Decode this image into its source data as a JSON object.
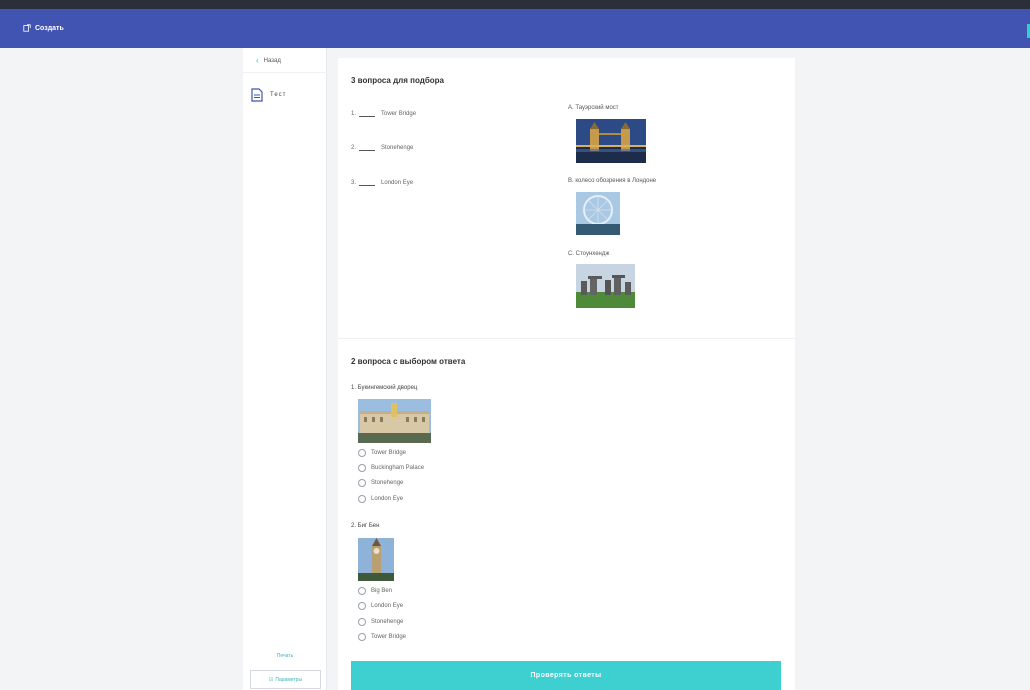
{
  "header": {
    "create_label": "Создать"
  },
  "sidebar": {
    "back_label": "Назад",
    "nav_item_label": "Тест",
    "print_label": "Печать",
    "params_label": "Параметры"
  },
  "matching": {
    "title": "3 вопроса для подбора",
    "items": [
      {
        "num": "1.",
        "text": "Tower Bridge"
      },
      {
        "num": "2.",
        "text": "Stonehenge"
      },
      {
        "num": "3.",
        "text": "London Eye"
      }
    ],
    "options": [
      {
        "label": "A. Тауэрский мост",
        "image": "tower-bridge-photo"
      },
      {
        "label": "B. колесо обозрения в Лондоне",
        "image": "london-eye-photo"
      },
      {
        "label": "C. Стоунхендж",
        "image": "stonehenge-photo"
      }
    ]
  },
  "choice": {
    "title": "2 вопроса с выбором ответа",
    "questions": [
      {
        "label": "1. Букингемский дворец",
        "image": "buckingham-palace-photo",
        "answers": [
          "Tower Bridge",
          "Buckingham Palace",
          "Stonehenge",
          "London Eye"
        ]
      },
      {
        "label": "2. Биг Бен",
        "image": "big-ben-photo",
        "answers": [
          "Big Ben",
          "London Eye",
          "Stonehenge",
          "Tower Bridge"
        ]
      }
    ]
  },
  "submit_label": "Проверять ответы",
  "colors": {
    "header": "#4254b2",
    "accent": "#3ecfd0",
    "link": "#3fb3b8"
  }
}
